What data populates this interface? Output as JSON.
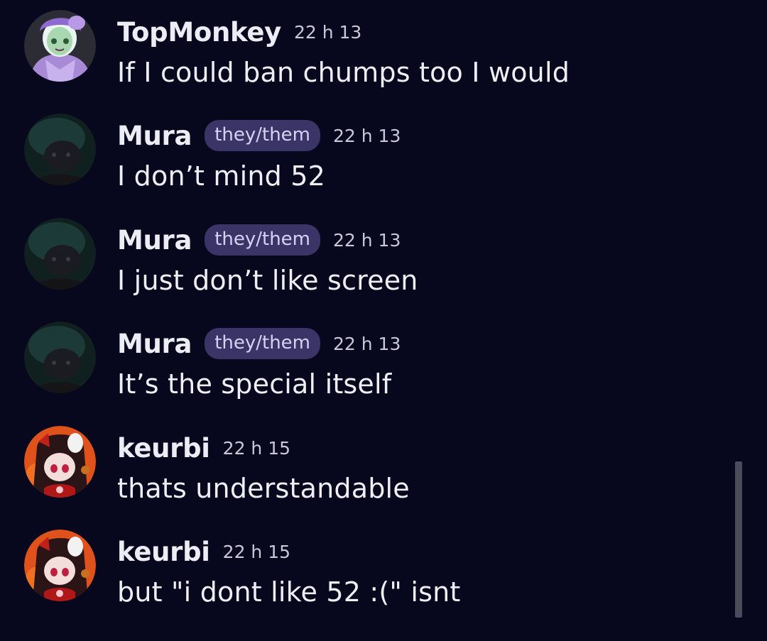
{
  "messages": [
    {
      "username": "TopMonkey",
      "pronouns": "",
      "time": "22 h 13",
      "text": "If I could ban chumps too I would",
      "avatar": "topmonkey-avatar"
    },
    {
      "username": "Mura",
      "pronouns": "they/them",
      "time": "22 h 13",
      "text": "I don’t mind 52",
      "avatar": "mura-avatar"
    },
    {
      "username": "Mura",
      "pronouns": "they/them",
      "time": "22 h 13",
      "text": "I just don’t like screen",
      "avatar": "mura-avatar"
    },
    {
      "username": "Mura",
      "pronouns": "they/them",
      "time": "22 h 13",
      "text": "It’s the special itself",
      "avatar": "mura-avatar"
    },
    {
      "username": "keurbi",
      "pronouns": "",
      "time": "22 h 15",
      "text": "thats understandable",
      "avatar": "keurbi-avatar"
    },
    {
      "username": "keurbi",
      "pronouns": "",
      "time": "22 h 15",
      "text": "but \"i dont like 52 :(\" isnt",
      "avatar": "keurbi-avatar"
    }
  ],
  "colors": {
    "background": "#07071d",
    "pronoun_badge": "#3b3466",
    "scrollbar": "#4b4b5b"
  }
}
